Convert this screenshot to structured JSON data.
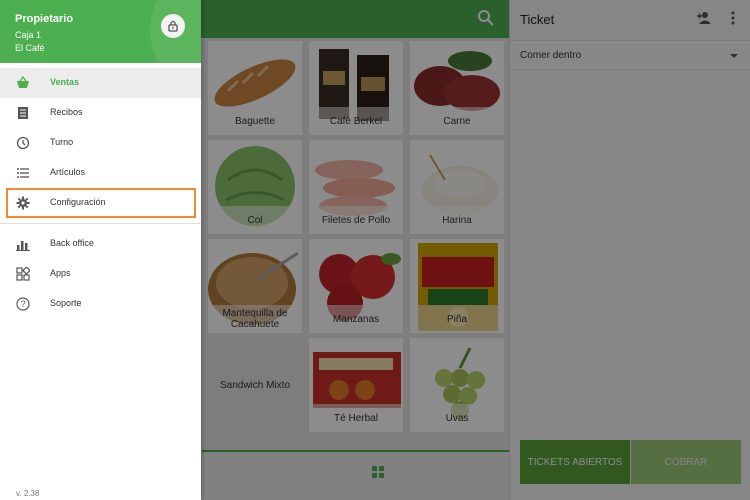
{
  "drawer": {
    "owner": "Propietario",
    "register": "Caja 1",
    "store": "El Café",
    "version": "v. 2.38",
    "menu_main": [
      {
        "label": "Ventas",
        "icon": "basket-icon",
        "active": true
      },
      {
        "label": "Recibos",
        "icon": "receipt-icon"
      },
      {
        "label": "Turno",
        "icon": "clock-icon"
      },
      {
        "label": "Artículos",
        "icon": "list-icon"
      },
      {
        "label": "Configuración",
        "icon": "gear-icon",
        "highlighted": true
      }
    ],
    "menu_secondary": [
      {
        "label": "Back office",
        "icon": "bar-chart-icon"
      },
      {
        "label": "Apps",
        "icon": "apps-icon"
      },
      {
        "label": "Soporte",
        "icon": "help-icon"
      }
    ]
  },
  "products": [
    {
      "label": "Baguette"
    },
    {
      "label": "Café Berkel"
    },
    {
      "label": "Carne"
    },
    {
      "label": "Col"
    },
    {
      "label": "Filetes de Pollo"
    },
    {
      "label": "Harina"
    },
    {
      "label": "Mantequilla de Cacahuete"
    },
    {
      "label": "Manzanas"
    },
    {
      "label": "Piña"
    },
    {
      "label": "Sandwich Mixto"
    },
    {
      "label": "Té Herbal"
    },
    {
      "label": "Uvas"
    }
  ],
  "ticket": {
    "title": "Ticket",
    "dining_option": "Comer dentro",
    "open_tickets_label": "TICKETS ABIERTOS",
    "charge_label": "COBRAR"
  },
  "colors": {
    "brand_green": "#4caf50",
    "highlight_orange": "#f5892f"
  }
}
